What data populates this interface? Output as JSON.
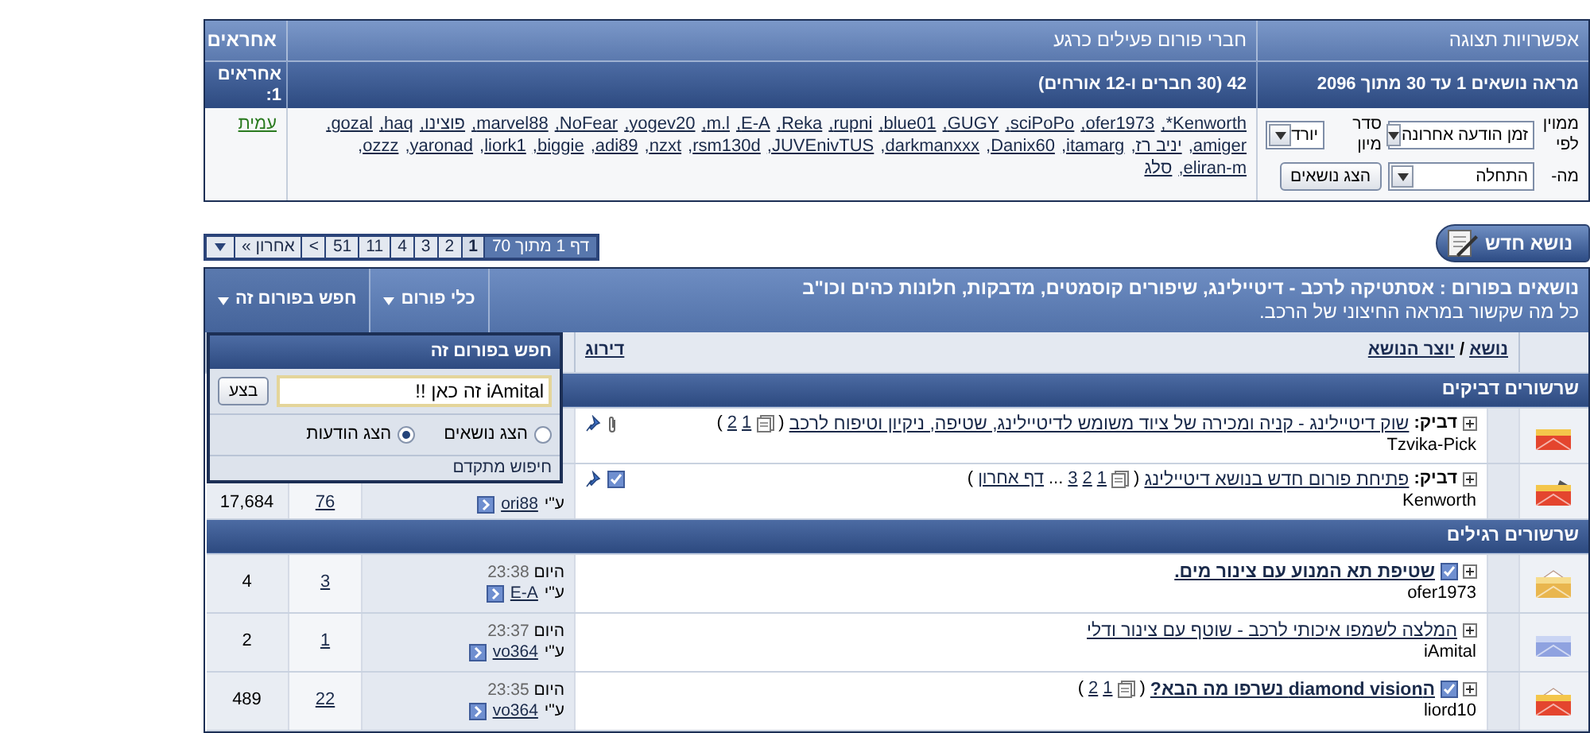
{
  "display_options": {
    "title": "אפשרויות תצוגה",
    "subtitle": "מראה נושאים 1 עד 30 מתוך 2096",
    "sort_by": {
      "label": "ממוין לפי",
      "value": "זמן הודעה אחרונה"
    },
    "sort_order": {
      "label": "סדר מיון",
      "value": "יורד"
    },
    "from": {
      "label": "מה-",
      "value": "התחלה"
    },
    "submit": "הצג נושאים"
  },
  "online_users": {
    "title": "חברי פורום פעילים כרגע",
    "count": "42 (30 חברים ו-12 אורחים)",
    "separator": ",",
    "names": [
      "Kenworth*",
      "ofer1973",
      "sciPoPo",
      "GUGY",
      "blue01",
      "rupni",
      "Reka",
      "E-A",
      "m.l",
      "yogev20",
      "NoFear",
      "marvel88",
      "פוצינו",
      "haq",
      "gozal",
      "amiger",
      "יניב רז",
      "itamarg",
      "Danix60",
      "darkmanxxx",
      "JUVEnivTUS",
      "rsm130d",
      "nzxt",
      "adi89",
      "biggie",
      "liork1",
      "yaronad",
      "ozzz",
      "eliran-m",
      "סלג"
    ]
  },
  "moderators": {
    "title": "אחראים",
    "count": "אחראים 1:",
    "names": [
      "עמית"
    ]
  },
  "new_topic_button": "נושא חדש",
  "pagination": {
    "summary": "דף 1 מתוך 70",
    "pages": [
      {
        "label": "1",
        "selected": true
      },
      {
        "label": "2",
        "selected": false
      },
      {
        "label": "3",
        "selected": false
      },
      {
        "label": "4",
        "selected": false
      },
      {
        "label": "11",
        "selected": false
      },
      {
        "label": "51",
        "selected": false
      }
    ],
    "next": "<",
    "last": "אחרון »"
  },
  "forum": {
    "title": "נושאים בפורום : אסתטיקה לרכב - דיטיילינג, שיפורים קוסמטים, מדבקות, חלונות כהים וכו\"ב",
    "description": "כל מה שקשור במראה החיצוני של הרכב.",
    "tools": [
      {
        "label": "כלי פורום",
        "open": false
      },
      {
        "label": "חפש בפורום זה",
        "open": true
      }
    ]
  },
  "search_popup": {
    "title": "חפש בפורום זה",
    "value": "iAmital זה כאן !!",
    "button": "בצע",
    "options": [
      {
        "label": "הצג נושאים",
        "selected": false
      },
      {
        "label": "הצג הודעות",
        "selected": true
      }
    ],
    "advanced": "חיפוש מתקדם"
  },
  "columns": {
    "title": "נושא",
    "separator": "/",
    "author": "יוצר הנושא",
    "rating": "דירוג"
  },
  "sections": [
    {
      "title": "שרשורים דביקים",
      "threads": [
        {
          "kind": "hot",
          "prefix": "דביק:",
          "title": "שוק דיטיילינג - קניה ומכירה של ציוד משומש לדיטיילינג, שטיפה, ניקיון וטיפוח לרכב",
          "unread": false,
          "checked": false,
          "pages": {
            "open": "(",
            "links": [
              "1",
              "2"
            ],
            "close": ")"
          },
          "author": "Tzvika-Pick",
          "pinned": true,
          "attachment": true,
          "subscribed": false
        },
        {
          "kind": "hot-posted",
          "prefix": "דביק:",
          "title": "פתיחת פורום חדש בנושא דיטיילינג",
          "unread": false,
          "checked": false,
          "pages": {
            "open": "(",
            "links": [
              "1",
              "2",
              "3"
            ],
            "ellipsis": "...",
            "last": "דף אחרון",
            "close": ")"
          },
          "author": "Kenworth",
          "pinned": true,
          "attachment": false,
          "subscribed": true,
          "last_post": {
            "by": "ע\"י",
            "user": "ori88"
          },
          "replies": "76",
          "views": "17,684"
        }
      ]
    },
    {
      "title": "שרשורים רגילים",
      "threads": [
        {
          "kind": "open",
          "title": "שטיפת תא המנוע עם צינור מים.",
          "unread": true,
          "checked": true,
          "author": "ofer1973",
          "pinned": false,
          "attachment": false,
          "subscribed": false,
          "last_post": {
            "date": "היום",
            "time": "23:38",
            "by": "ע\"י",
            "user": "E-A"
          },
          "replies": "3",
          "views": "4"
        },
        {
          "kind": "new",
          "title": "המלצה לשמפו איכותי לרכב - שוטף עם צינור ודלי",
          "unread": false,
          "checked": false,
          "author": "iAmital",
          "pinned": false,
          "attachment": false,
          "subscribed": false,
          "last_post": {
            "date": "היום",
            "time": "23:37",
            "by": "ע\"י",
            "user": "vo364"
          },
          "replies": "1",
          "views": "2"
        },
        {
          "kind": "hot-open",
          "title": "הdiamond vision נשרפו מה הבא?",
          "unread": true,
          "checked": true,
          "pages": {
            "open": "(",
            "links": [
              "1",
              "2"
            ],
            "close": ")"
          },
          "author": "liord10",
          "pinned": false,
          "attachment": false,
          "subscribed": false,
          "last_post": {
            "date": "היום",
            "time": "23:35",
            "by": "ע\"י",
            "user": "vo364"
          },
          "replies": "22",
          "views": "489"
        }
      ]
    }
  ]
}
